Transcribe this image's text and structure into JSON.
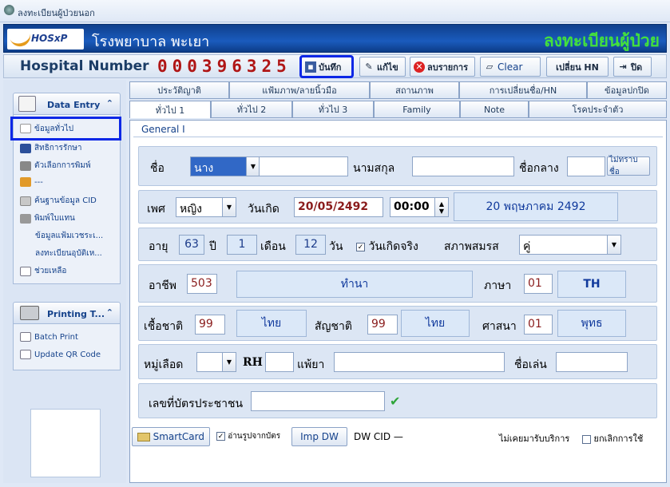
{
  "window": {
    "title": "ลงทะเบียนผู้ป่วยนอก"
  },
  "header": {
    "logo_text": "HOSxP",
    "hospital_name": "โรงพยาบาล พะเยา",
    "page_title": "ลงทะเบียนผู้ป่วย"
  },
  "toolbar": {
    "hn_label": "Hospital Number",
    "hn_value": "000396325",
    "save": "บันทึก",
    "edit": "แก้ไข",
    "delete": "ลบรายการ",
    "clear": "Clear",
    "change_hn": "เปลี่ยน HN",
    "close": "ปิด"
  },
  "sidebar": {
    "data_entry_title": "Data Entry",
    "data_entry_items": [
      "ข้อมูลทั่วไป",
      "สิทธิการรักษา",
      "ตัวเลือกการพิมพ์",
      "---",
      "ค้นฐานข้อมูล CID",
      "พิมพ์ใบแทน",
      "ข้อมูลแฟ้มเวชระเ...",
      "ลงทะเบียนอุบัติเห...",
      "ช่วยเหลือ"
    ],
    "printing_title": "Printing T...",
    "printing_items": [
      "Batch Print",
      "Update QR Code"
    ]
  },
  "tabs": {
    "row1": [
      "ประวัติญาติ",
      "แฟ้มภาพ/ลายนิ้วมือ",
      "สถานภาพ",
      "การเปลี่ยนชื่อ/HN",
      "ข้อมูลปกปิด"
    ],
    "row2": [
      "ทั่วไป 1",
      "ทั่วไป 2",
      "ทั่วไป 3",
      "Family",
      "Note",
      "โรคประจำตัว"
    ]
  },
  "form": {
    "section_title": "General I",
    "name_label": "ชื่อ",
    "prefix": "นาง",
    "first_name": "",
    "surname_label": "นามสกุล",
    "surname": "",
    "middle_label": "ชื่อกลาง",
    "middle": "",
    "unknown_name_btn": "ไม่ทราบชื่อ",
    "sex_label": "เพศ",
    "sex": "หญิง",
    "birth_label": "วันเกิด",
    "birthdate": "20/05/2492",
    "birth_time": "00:00",
    "birth_text": "20 พฤษภาคม 2492",
    "age_label": "อายุ",
    "age_years": "63",
    "years_unit": "ปี",
    "age_months": "1",
    "months_unit": "เดือน",
    "age_days": "12",
    "days_unit": "วัน",
    "real_birth_label": "วันเกิดจริง",
    "marital_label": "สภาพสมรส",
    "marital": "คู่",
    "occupation_label": "อาชีพ",
    "occupation_code": "503",
    "occupation_name": "ทำนา",
    "language_label": "ภาษา",
    "language_code": "01",
    "language_name": "TH",
    "race_label": "เชื้อชาติ",
    "race_code": "99",
    "race_name": "ไทย",
    "nationality_label": "สัญชาติ",
    "nationality_code": "99",
    "nationality_name": "ไทย",
    "religion_label": "ศาสนา",
    "religion_code": "01",
    "religion_name": "พุทธ",
    "blood_label": "หมู่เลือด",
    "blood": "",
    "rh_label": "RH",
    "rh": "",
    "allergy_label": "แพ้ยา",
    "allergy": "",
    "nickname_label": "ชื่อเล่น",
    "nickname": "",
    "cid_label": "เลขที่บัตรประชาชน",
    "cid_value": "",
    "smartcard_btn": "SmartCard",
    "read_card_label": "อ่านรูปจากบัตร",
    "imp_dw_btn": "Imp DW",
    "dw_cid_label": "DW CID —",
    "never_served_label": "ไม่เคยมารับบริการ",
    "cancel_use_label": "ยกเลิกการใช้"
  }
}
